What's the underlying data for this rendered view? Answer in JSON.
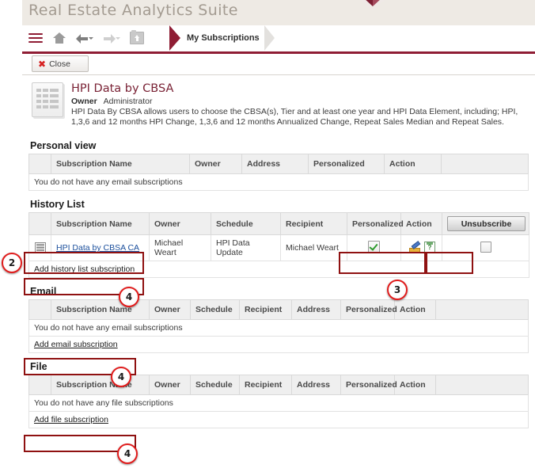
{
  "app": {
    "title": "Real Estate Analytics Suite",
    "breadcrumb": "My Subscriptions",
    "close_label": "Close"
  },
  "toolbar": {
    "icons": [
      "menu-icon",
      "home-icon",
      "back-arrow-icon",
      "forward-arrow-icon",
      "folder-up-icon"
    ]
  },
  "report": {
    "title": "HPI Data by CBSA",
    "owner_label": "Owner",
    "owner_value": "Administrator",
    "description": "HPI Data By CBSA allows users to choose the CBSA(s), Tier and at least one year and HPI Data Element, including; HPI, 1,3,6 and 12 months HPI Change, 1,3,6 and 12 months Annualized Change, Repeat Sales Median and Repeat Sales."
  },
  "sections": {
    "personal": {
      "heading": "Personal view",
      "columns": [
        "",
        "Subscription Name",
        "Owner",
        "Address",
        "Personalized",
        "Action",
        ""
      ],
      "empty_text": "You do not have any email subscriptions"
    },
    "history": {
      "heading": "History List",
      "columns": [
        "",
        "Subscription Name",
        "Owner",
        "Schedule",
        "Recipient",
        "Personalized",
        "Action",
        ""
      ],
      "unsubscribe_label": "Unsubscribe",
      "rows": [
        {
          "icon": "grid-icon",
          "name": "HPI Data by CBSA CA",
          "owner": "Michael Weart",
          "schedule": "HPI Data Update",
          "recipient": "Michael Weart",
          "personalized": "checked",
          "actions": [
            "edit-icon",
            "doc-info-icon"
          ],
          "unsubscribe_checked": false
        }
      ],
      "add_link": "Add history list subscription"
    },
    "email": {
      "heading": "Email",
      "columns": [
        "",
        "Subscription Name",
        "Owner",
        "Schedule",
        "Recipient",
        "Address",
        "Personalized",
        "Action",
        ""
      ],
      "empty_text": "You do not have any email subscriptions",
      "add_link": "Add email subscription"
    },
    "file": {
      "heading": "File",
      "columns": [
        "",
        "Subscription Name",
        "Owner",
        "Schedule",
        "Recipient",
        "Address",
        "Personalized",
        "Action",
        ""
      ],
      "empty_text": "You do not have any file subscriptions",
      "add_link": "Add file subscription"
    }
  },
  "annotations": [
    {
      "number": "2"
    },
    {
      "number": "3"
    },
    {
      "number": "4"
    },
    {
      "number": "4"
    },
    {
      "number": "4"
    }
  ],
  "colors": {
    "brand_red": "#8f1d34",
    "banner_bg": "#eeeae4",
    "title_gray": "#a39b91",
    "annotation_red": "#e01b1b",
    "highlight_red": "#8f1111",
    "link_blue": "#1b4f9c"
  }
}
